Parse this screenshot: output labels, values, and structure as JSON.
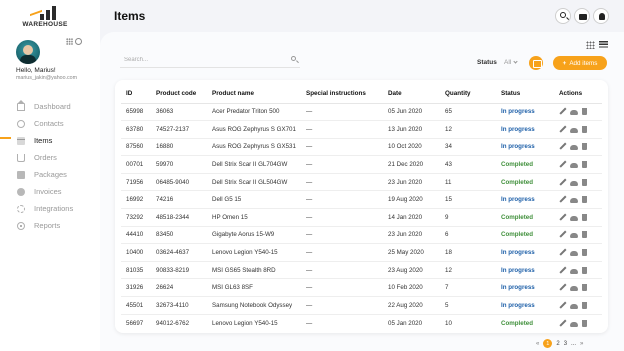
{
  "app": {
    "logo_text": "WAREHOUSE"
  },
  "user": {
    "greeting": "Hello, Marius!",
    "email": "marius_jakin@yahoo.com"
  },
  "sidebar": {
    "items": [
      {
        "label": "Dashboard",
        "icon": "home-icon"
      },
      {
        "label": "Contacts",
        "icon": "contact-icon"
      },
      {
        "label": "Items",
        "icon": "items-icon",
        "active": true
      },
      {
        "label": "Orders",
        "icon": "cart-icon"
      },
      {
        "label": "Packages",
        "icon": "package-icon"
      },
      {
        "label": "Invoices",
        "icon": "invoice-icon"
      },
      {
        "label": "Integrations",
        "icon": "integrations-icon"
      },
      {
        "label": "Reports",
        "icon": "reports-icon"
      }
    ]
  },
  "header": {
    "title": "Items"
  },
  "toolbar": {
    "search_placeholder": "Search...",
    "status_label": "Status",
    "status_value": "All",
    "add_label": "Add items",
    "accent_color": "#f7a21b"
  },
  "table": {
    "columns": [
      "ID",
      "Product code",
      "Product name",
      "Special instructions",
      "Date",
      "Quantity",
      "Status",
      "Actions"
    ],
    "rows": [
      {
        "id": "65998",
        "code": "36063",
        "name": "Acer Predator Triton 500",
        "instructions": "—",
        "date": "05 Jun 2020",
        "qty": "65",
        "status": "In progress"
      },
      {
        "id": "63780",
        "code": "74527-2137",
        "name": "Asus ROG Zephyrus S GX701",
        "instructions": "—",
        "date": "13 Jun 2020",
        "qty": "12",
        "status": "In progress"
      },
      {
        "id": "87560",
        "code": "16880",
        "name": "Asus ROG Zephyrus S GX531",
        "instructions": "—",
        "date": "10 Oct 2020",
        "qty": "34",
        "status": "In progress"
      },
      {
        "id": "00701",
        "code": "59970",
        "name": "Dell Strix Scar II GL704GW",
        "instructions": "—",
        "date": "21 Dec 2020",
        "qty": "43",
        "status": "Completed"
      },
      {
        "id": "71956",
        "code": "06485-9040",
        "name": "Dell Strix Scar II GL504GW",
        "instructions": "—",
        "date": "23 Jun 2020",
        "qty": "11",
        "status": "Completed"
      },
      {
        "id": "16992",
        "code": "74216",
        "name": "Dell G5 15",
        "instructions": "—",
        "date": "19 Aug 2020",
        "qty": "15",
        "status": "In progress"
      },
      {
        "id": "73292",
        "code": "48518-2344",
        "name": "HP Omen 15",
        "instructions": "—",
        "date": "14 Jan 2020",
        "qty": "9",
        "status": "Completed"
      },
      {
        "id": "44410",
        "code": "83450",
        "name": "Gigabyte  Aorus 15-W9",
        "instructions": "—",
        "date": "23 Jun 2020",
        "qty": "6",
        "status": "Completed"
      },
      {
        "id": "10400",
        "code": "03624-4637",
        "name": "Lenovo Legion Y540-15",
        "instructions": "—",
        "date": "25 May 2020",
        "qty": "18",
        "status": "In progress"
      },
      {
        "id": "81035",
        "code": "90833-8219",
        "name": "MSI GS65 Stealth 8RD",
        "instructions": "—",
        "date": "23 Aug 2020",
        "qty": "12",
        "status": "In progress"
      },
      {
        "id": "31926",
        "code": "26624",
        "name": "MSI GL63 8SF",
        "instructions": "—",
        "date": "10 Feb 2020",
        "qty": "7",
        "status": "In progress"
      },
      {
        "id": "45501",
        "code": "32673-4110",
        "name": "Samsung  Notebook Odyssey",
        "instructions": "—",
        "date": "22 Aug 2020",
        "qty": "5",
        "status": "In progress"
      },
      {
        "id": "56697",
        "code": "94012-6762",
        "name": "Lenovo Legion Y540-15",
        "instructions": "—",
        "date": "05 Jan 2020",
        "qty": "10",
        "status": "Completed"
      }
    ]
  },
  "pagination": {
    "prev": "«",
    "pages": [
      "1",
      "2",
      "3"
    ],
    "current": "1",
    "ellipsis": "...",
    "next": "»"
  }
}
